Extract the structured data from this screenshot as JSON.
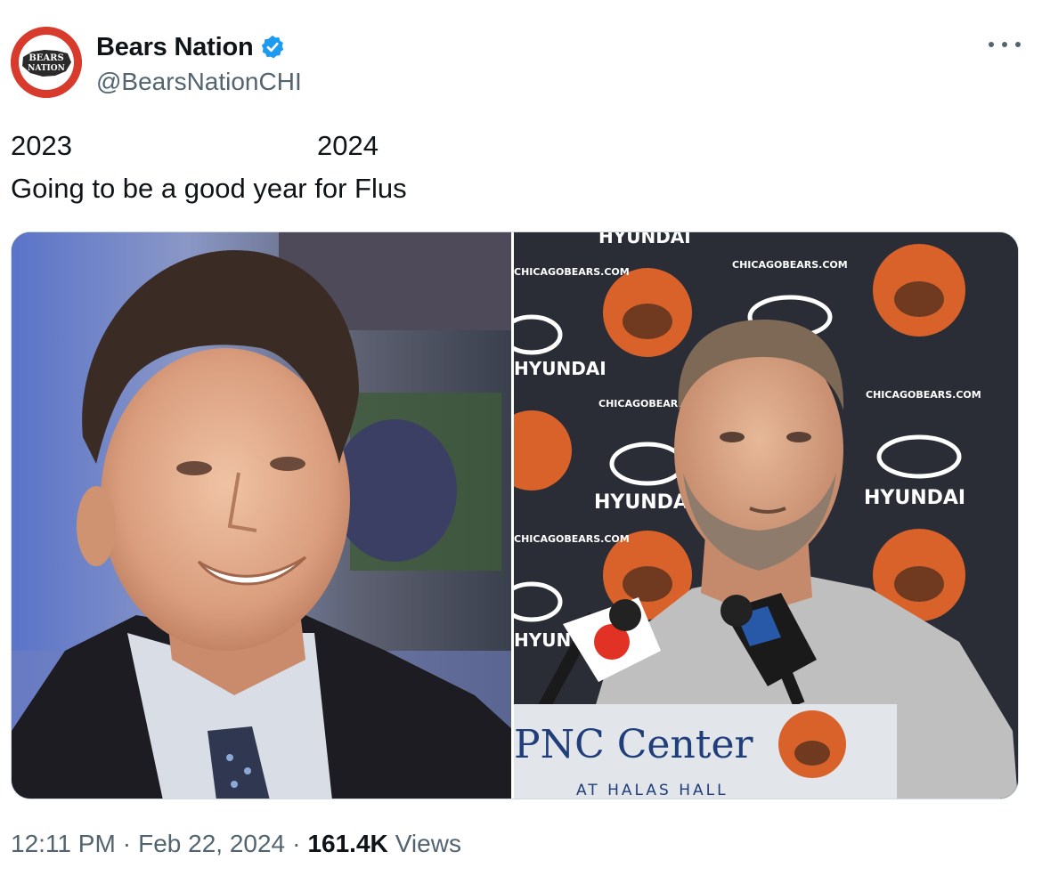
{
  "account": {
    "display_name": "Bears Nation",
    "handle": "@BearsNationCHI",
    "verified": true,
    "avatar_text_top": "BEARS",
    "avatar_text_bottom": "NATION",
    "avatar_icon": "bears-nation-logo"
  },
  "post": {
    "year_left": "2023",
    "year_right": "2024",
    "body": "Going to be a good year for Flus"
  },
  "media": {
    "left_image": "man-in-suit-smiling-photo",
    "right_image": "man-at-press-conference-photo",
    "backdrop_sponsor": "HYUNDAI",
    "backdrop_site": "CHICAGOBEARS.COM",
    "podium_text": "PNC Center",
    "podium_subtext": "AT HALAS HALL"
  },
  "meta": {
    "time": "12:11 PM",
    "separator": "·",
    "date": "Feb 22, 2024",
    "views_count": "161.4K",
    "views_label": "Views"
  },
  "colors": {
    "text_primary": "#0f1419",
    "text_secondary": "#536471",
    "verified_blue": "#1d9bf0",
    "border": "#cfd9de",
    "avatar_red": "#d83a2c",
    "bears_orange": "#d9622b"
  },
  "icons": {
    "more": "more-horizontal-icon",
    "verified": "verified-badge-icon"
  }
}
